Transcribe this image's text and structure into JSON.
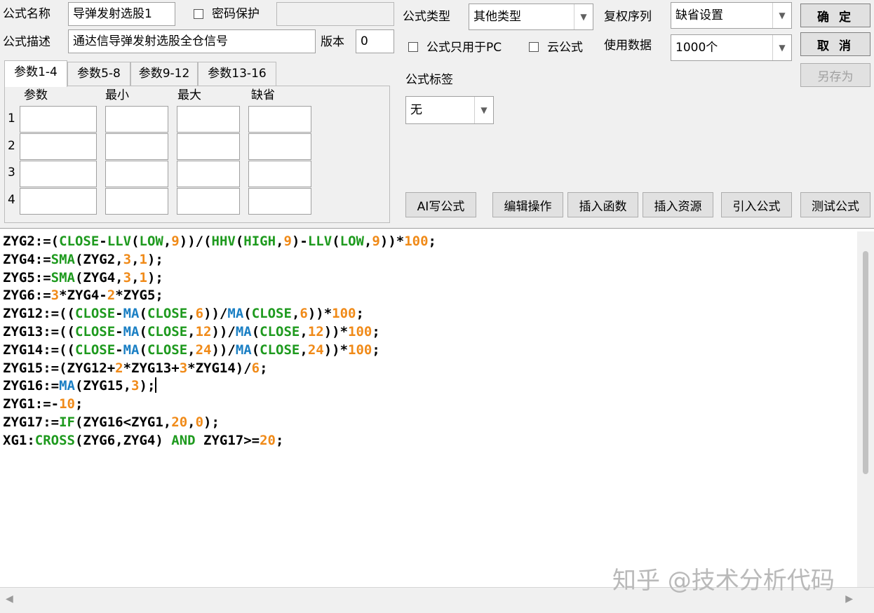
{
  "top": {
    "name_label": "公式名称",
    "name_value": "导弹发射选股1",
    "password_label": "密码保护",
    "desc_label": "公式描述",
    "desc_value": "通达信导弹发射选股全仓信号",
    "version_label": "版本",
    "version_value": "0",
    "type_label": "公式类型",
    "type_value": "其他类型",
    "rights_label": "复权序列",
    "rights_value": "缺省设置",
    "pc_only_label": "公式只用于PC",
    "cloud_label": "云公式",
    "data_label": "使用数据",
    "data_value": "1000个",
    "tag_label": "公式标签",
    "tag_value": "无"
  },
  "buttons": {
    "ok": "确 定",
    "cancel": "取 消",
    "save_as": "另存为",
    "ai": "AI写公式",
    "edit": "编辑操作",
    "insert_func": "插入函数",
    "insert_res": "插入资源",
    "import": "引入公式",
    "test": "测试公式"
  },
  "params": {
    "tabs": [
      "参数1-4",
      "参数5-8",
      "参数9-12",
      "参数13-16"
    ],
    "headers": [
      "参数",
      "最小",
      "最大",
      "缺省"
    ],
    "rows": [
      "1",
      "2",
      "3",
      "4"
    ]
  },
  "code": [
    [
      [
        "ZYG2:=(",
        "black"
      ],
      [
        "CLOSE",
        "green"
      ],
      [
        "-",
        "black"
      ],
      [
        "LLV",
        "green"
      ],
      [
        "(",
        "black"
      ],
      [
        "LOW",
        "green"
      ],
      [
        ",",
        "black"
      ],
      [
        "9",
        "orange"
      ],
      [
        "))/(",
        "black"
      ],
      [
        "HHV",
        "green"
      ],
      [
        "(",
        "black"
      ],
      [
        "HIGH",
        "green"
      ],
      [
        ",",
        "black"
      ],
      [
        "9",
        "orange"
      ],
      [
        ")-",
        "black"
      ],
      [
        "LLV",
        "green"
      ],
      [
        "(",
        "black"
      ],
      [
        "LOW",
        "green"
      ],
      [
        ",",
        "black"
      ],
      [
        "9",
        "orange"
      ],
      [
        "))*",
        "black"
      ],
      [
        "100",
        "orange"
      ],
      [
        ";",
        "black"
      ]
    ],
    [
      [
        "ZYG4:=",
        "black"
      ],
      [
        "SMA",
        "green"
      ],
      [
        "(ZYG2,",
        "black"
      ],
      [
        "3",
        "orange"
      ],
      [
        ",",
        "black"
      ],
      [
        "1",
        "orange"
      ],
      [
        ");",
        "black"
      ]
    ],
    [
      [
        "ZYG5:=",
        "black"
      ],
      [
        "SMA",
        "green"
      ],
      [
        "(ZYG4,",
        "black"
      ],
      [
        "3",
        "orange"
      ],
      [
        ",",
        "black"
      ],
      [
        "1",
        "orange"
      ],
      [
        ");",
        "black"
      ]
    ],
    [
      [
        "ZYG6:=",
        "black"
      ],
      [
        "3",
        "orange"
      ],
      [
        "*ZYG4-",
        "black"
      ],
      [
        "2",
        "orange"
      ],
      [
        "*ZYG5;",
        "black"
      ]
    ],
    [
      [
        "ZYG12:=((",
        "black"
      ],
      [
        "CLOSE",
        "green"
      ],
      [
        "-",
        "black"
      ],
      [
        "MA",
        "blue"
      ],
      [
        "(",
        "black"
      ],
      [
        "CLOSE",
        "green"
      ],
      [
        ",",
        "black"
      ],
      [
        "6",
        "orange"
      ],
      [
        "))/",
        "black"
      ],
      [
        "MA",
        "blue"
      ],
      [
        "(",
        "black"
      ],
      [
        "CLOSE",
        "green"
      ],
      [
        ",",
        "black"
      ],
      [
        "6",
        "orange"
      ],
      [
        "))*",
        "black"
      ],
      [
        "100",
        "orange"
      ],
      [
        ";",
        "black"
      ]
    ],
    [
      [
        "ZYG13:=((",
        "black"
      ],
      [
        "CLOSE",
        "green"
      ],
      [
        "-",
        "black"
      ],
      [
        "MA",
        "blue"
      ],
      [
        "(",
        "black"
      ],
      [
        "CLOSE",
        "green"
      ],
      [
        ",",
        "black"
      ],
      [
        "12",
        "orange"
      ],
      [
        "))/",
        "black"
      ],
      [
        "MA",
        "blue"
      ],
      [
        "(",
        "black"
      ],
      [
        "CLOSE",
        "green"
      ],
      [
        ",",
        "black"
      ],
      [
        "12",
        "orange"
      ],
      [
        "))*",
        "black"
      ],
      [
        "100",
        "orange"
      ],
      [
        ";",
        "black"
      ]
    ],
    [
      [
        "ZYG14:=((",
        "black"
      ],
      [
        "CLOSE",
        "green"
      ],
      [
        "-",
        "black"
      ],
      [
        "MA",
        "blue"
      ],
      [
        "(",
        "black"
      ],
      [
        "CLOSE",
        "green"
      ],
      [
        ",",
        "black"
      ],
      [
        "24",
        "orange"
      ],
      [
        "))/",
        "black"
      ],
      [
        "MA",
        "blue"
      ],
      [
        "(",
        "black"
      ],
      [
        "CLOSE",
        "green"
      ],
      [
        ",",
        "black"
      ],
      [
        "24",
        "orange"
      ],
      [
        "))*",
        "black"
      ],
      [
        "100",
        "orange"
      ],
      [
        ";",
        "black"
      ]
    ],
    [
      [
        "ZYG15:=(ZYG12+",
        "black"
      ],
      [
        "2",
        "orange"
      ],
      [
        "*ZYG13+",
        "black"
      ],
      [
        "3",
        "orange"
      ],
      [
        "*ZYG14)/",
        "black"
      ],
      [
        "6",
        "orange"
      ],
      [
        ";",
        "black"
      ]
    ],
    [
      [
        "ZYG16:=",
        "black"
      ],
      [
        "MA",
        "blue"
      ],
      [
        "(ZYG15,",
        "black"
      ],
      [
        "3",
        "orange"
      ],
      [
        ");",
        "black"
      ]
    ],
    [
      [
        "ZYG1:=-",
        "black"
      ],
      [
        "10",
        "orange"
      ],
      [
        ";",
        "black"
      ]
    ],
    [
      [
        "ZYG17:=",
        "black"
      ],
      [
        "IF",
        "green"
      ],
      [
        "(ZYG16<ZYG1,",
        "black"
      ],
      [
        "20",
        "orange"
      ],
      [
        ",",
        "black"
      ],
      [
        "0",
        "orange"
      ],
      [
        ");",
        "black"
      ]
    ],
    [
      [
        "XG1:",
        "black"
      ],
      [
        "CROSS",
        "green"
      ],
      [
        "(ZYG6,ZYG4) ",
        "black"
      ],
      [
        "AND",
        "green"
      ],
      [
        " ZYG17>=",
        "black"
      ],
      [
        "20",
        "orange"
      ],
      [
        ";",
        "black"
      ]
    ]
  ],
  "watermark": "知乎 @技术分析代码",
  "icons": {
    "combo_arrow": "chevron-down-icon",
    "scroll_left": "triangle-left-icon",
    "scroll_right": "triangle-right-icon"
  }
}
